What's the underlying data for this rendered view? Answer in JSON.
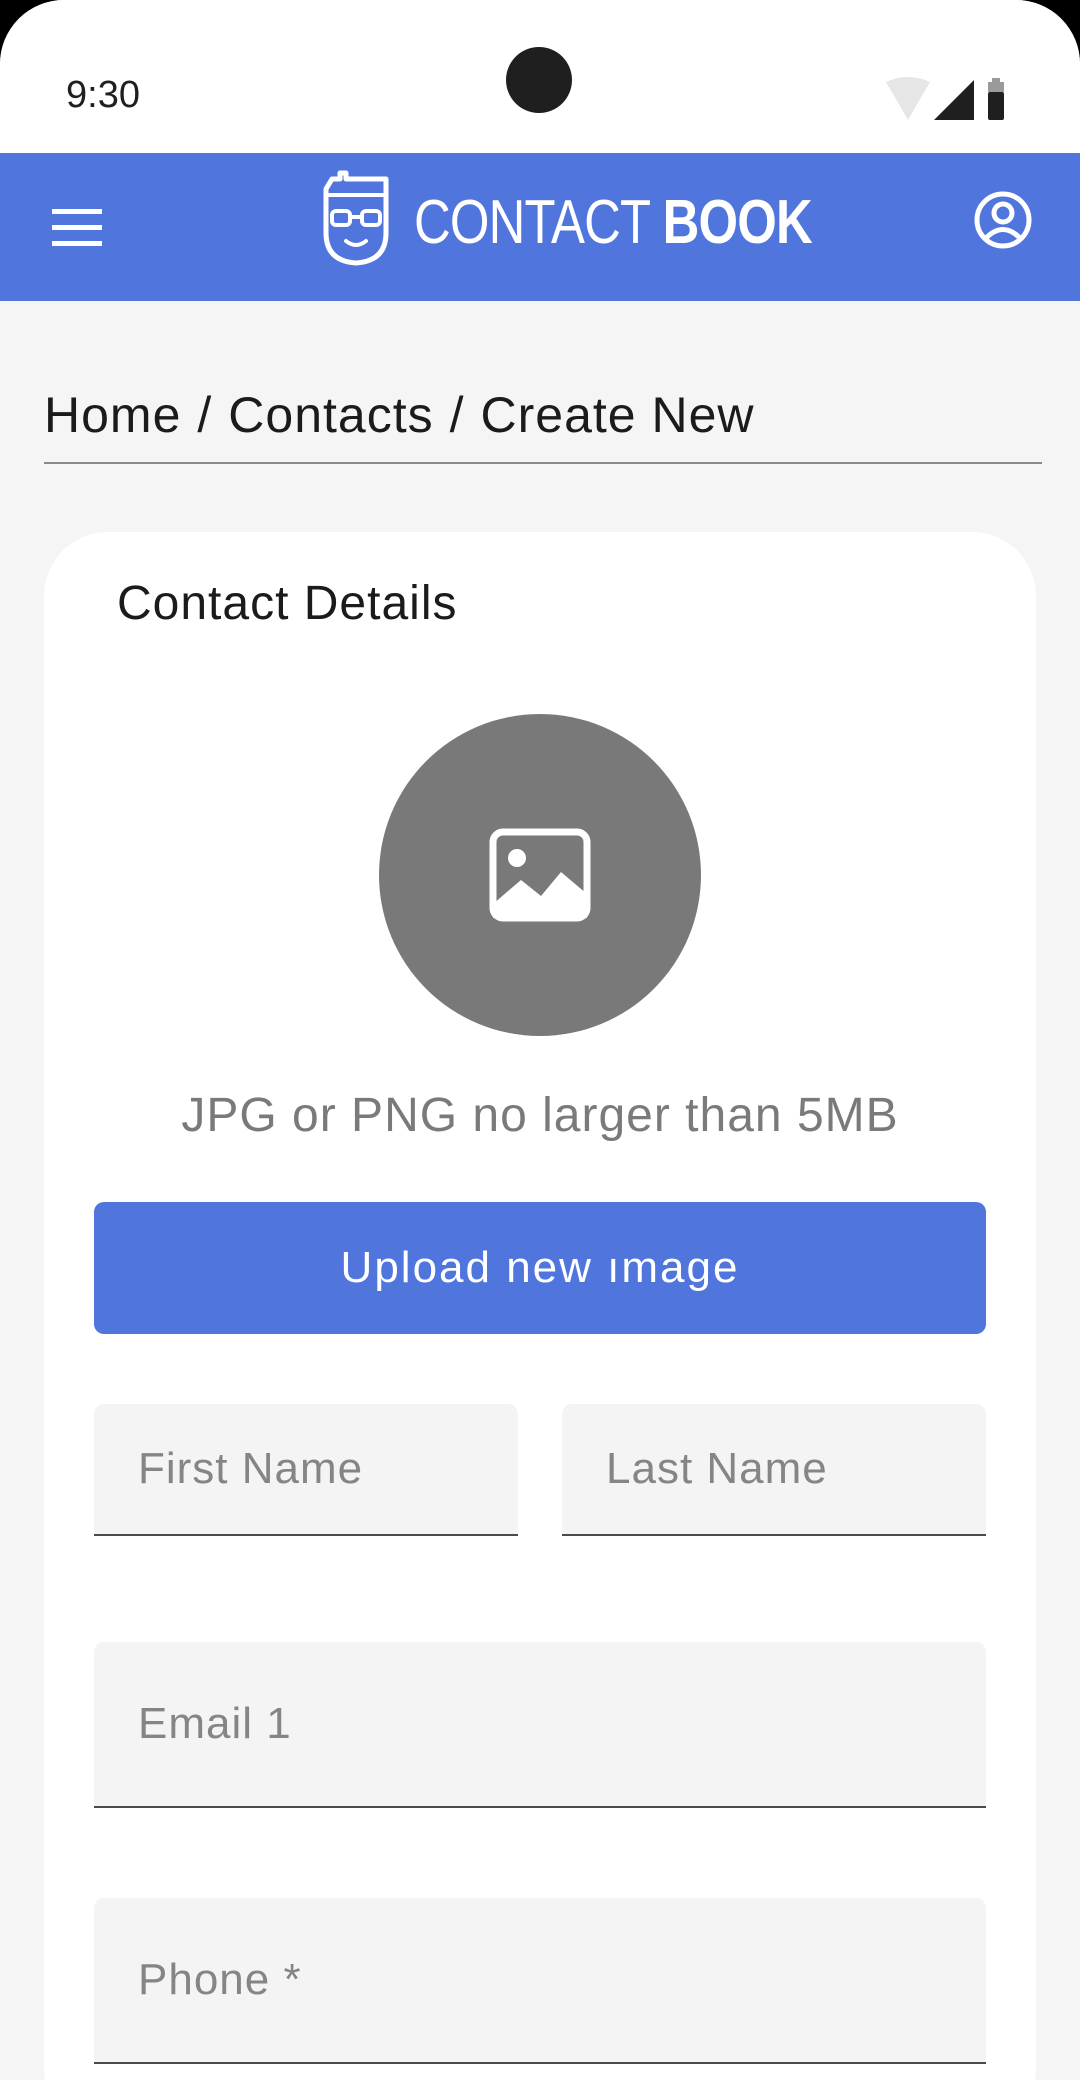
{
  "status_bar": {
    "time": "9:30"
  },
  "app_bar": {
    "logo_text_light": "CONTACT",
    "logo_text_bold": "BOOK",
    "color": "#5076dd"
  },
  "breadcrumb": {
    "items": [
      "Home",
      "Contacts",
      "Create New"
    ],
    "separator": "/"
  },
  "card": {
    "title": "Contact Details",
    "image_hint": "JPG or PNG no larger than 5MB",
    "upload_button": "Upload new ımage",
    "fields": {
      "first_name": {
        "placeholder": "First Name",
        "value": ""
      },
      "last_name": {
        "placeholder": "Last Name",
        "value": ""
      },
      "email": {
        "placeholder": "Email 1",
        "value": ""
      },
      "phone": {
        "placeholder": "Phone *",
        "value": ""
      }
    }
  },
  "icons": [
    "menu-icon",
    "contact-book-logo-icon",
    "account-circle-icon",
    "image-placeholder-icon",
    "wifi-icon",
    "cellular-signal-icon",
    "battery-icon"
  ]
}
